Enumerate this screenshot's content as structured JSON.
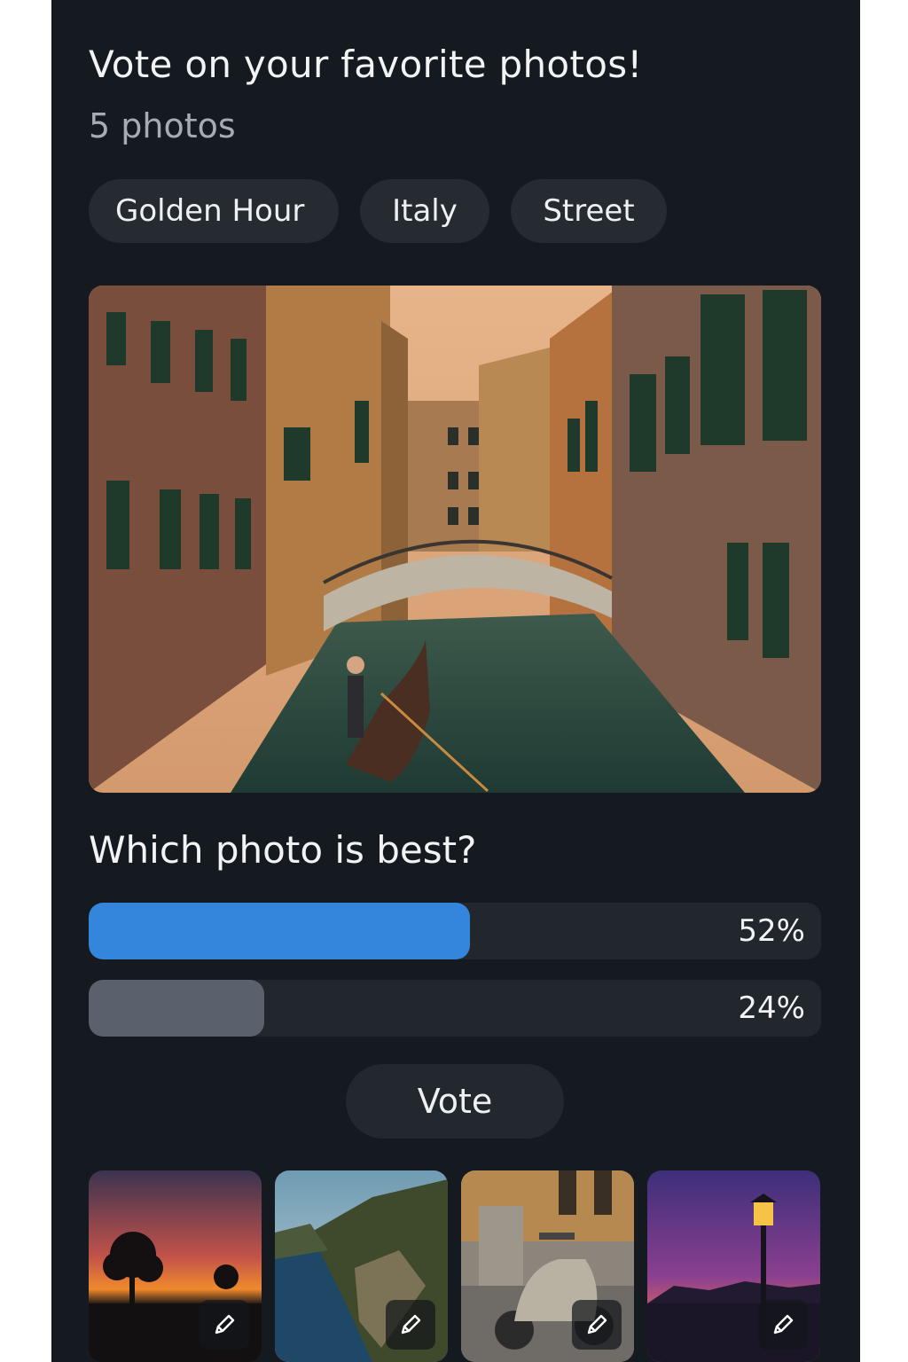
{
  "header": {
    "title": "Vote on your favorite photos!",
    "subtitle": "5 photos"
  },
  "tags": [
    "Golden Hour",
    "Italy",
    "Street"
  ],
  "hero": {
    "icon": "venice-canal-photo"
  },
  "poll": {
    "question": "Which photo is best?",
    "options": [
      {
        "percent_label": "52%",
        "percent": 52
      },
      {
        "percent_label": "24%",
        "percent": 24
      }
    ],
    "vote_label": "Vote"
  },
  "thumbnails": [
    {
      "icon": "sunset-tree-photo",
      "edit_icon": "pencil-icon"
    },
    {
      "icon": "coastline-photo",
      "edit_icon": "pencil-icon"
    },
    {
      "icon": "scooter-street-photo",
      "edit_icon": "pencil-icon"
    },
    {
      "icon": "street-lamp-dusk-photo",
      "edit_icon": "pencil-icon"
    }
  ],
  "colors": {
    "background": "#151920",
    "accent": "#3386db",
    "secondary_bar": "#5b616c"
  }
}
